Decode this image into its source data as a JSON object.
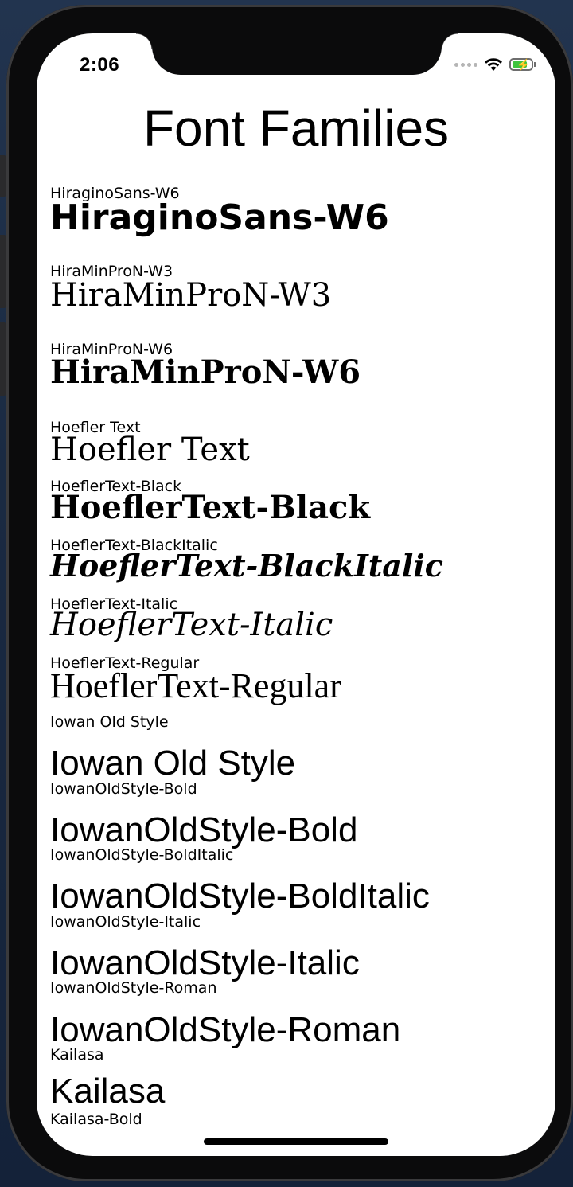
{
  "status_bar": {
    "time": "2:06"
  },
  "header": {
    "title": "Font Families"
  },
  "fonts": [
    {
      "label": "HiraginoSans-W6",
      "sample": "HiraginoSans-W6"
    },
    {
      "label": "HiraMinProN-W3",
      "sample": "HiraMinProN-W3"
    },
    {
      "label": "HiraMinProN-W6",
      "sample": "HiraMinProN-W6"
    },
    {
      "label": "Hoefler Text",
      "sample": "Hoefler Text"
    },
    {
      "label": "HoeflerText-Black",
      "sample": "HoeflerText-Black"
    },
    {
      "label": "HoeflerText-BlackItalic",
      "sample": "HoeflerText-BlackItalic"
    },
    {
      "label": "HoeflerText-Italic",
      "sample": "HoeflerText-Italic"
    },
    {
      "label": "HoeflerText-Regular",
      "sample": "HoeflerText-Regular"
    },
    {
      "label": "Iowan Old Style",
      "sample": "Iowan Old Style"
    },
    {
      "label": "IowanOldStyle-Bold",
      "sample": "IowanOldStyle-Bold"
    },
    {
      "label": "IowanOldStyle-BoldItalic",
      "sample": "IowanOldStyle-BoldItalic"
    },
    {
      "label": "IowanOldStyle-Italic",
      "sample": "IowanOldStyle-Italic"
    },
    {
      "label": "IowanOldStyle-Roman",
      "sample": "IowanOldStyle-Roman"
    },
    {
      "label": "Kailasa",
      "sample": "Kailasa"
    },
    {
      "label": "Kailasa-Bold"
    }
  ],
  "colors": {
    "battery": "#3ec43e",
    "background": "#ffffff",
    "text": "#000000"
  },
  "icons": [
    "cellular-signal-icon",
    "wifi-icon",
    "battery-charging-icon"
  ]
}
